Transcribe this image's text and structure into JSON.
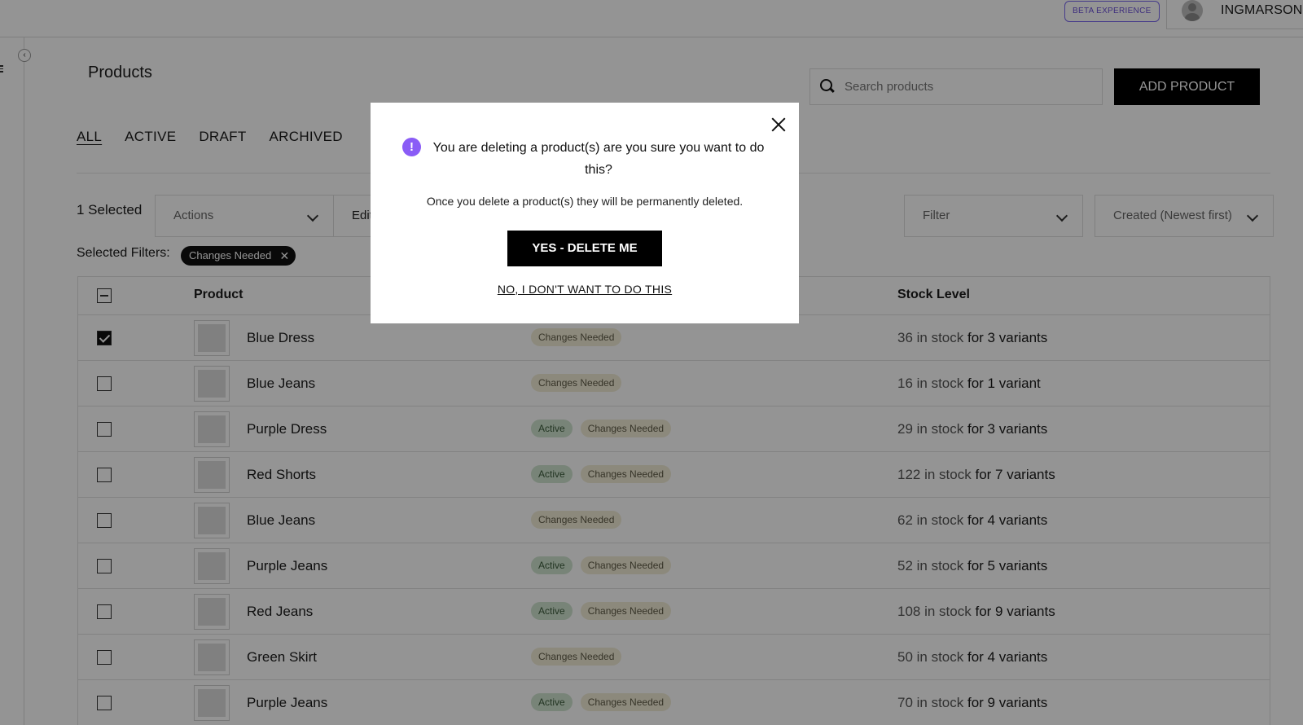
{
  "header": {
    "beta_label": "BETA EXPERIENCE",
    "username": "INGMARSON"
  },
  "page": {
    "title": "Products",
    "search_placeholder": "Search products",
    "add_button": "ADD PRODUCT",
    "tabs": [
      "ALL",
      "ACTIVE",
      "DRAFT",
      "ARCHIVED"
    ],
    "active_tab": "ALL",
    "selected_count": "1 Selected",
    "actions_label": "Actions",
    "edit_label": "Edit",
    "filter_label": "Filter",
    "sort_label": "Created (Newest first)",
    "selected_filters_label": "Selected Filters:",
    "filter_chip": "Changes Needed"
  },
  "table": {
    "headers": {
      "product": "Product",
      "stock": "Stock Level"
    },
    "rows": [
      {
        "name": "Blue Dress",
        "checked": true,
        "badges": [
          "Changes Needed"
        ],
        "stock_a": "36 in stock",
        "stock_b": "for 3 variants"
      },
      {
        "name": "Blue Jeans",
        "checked": false,
        "badges": [
          "Changes Needed"
        ],
        "stock_a": "16 in stock",
        "stock_b": "for 1 variant"
      },
      {
        "name": "Purple Dress",
        "checked": false,
        "badges": [
          "Active",
          "Changes Needed"
        ],
        "stock_a": "29 in stock",
        "stock_b": "for 3 variants"
      },
      {
        "name": "Red Shorts",
        "checked": false,
        "badges": [
          "Active",
          "Changes Needed"
        ],
        "stock_a": "122 in stock",
        "stock_b": "for 7 variants"
      },
      {
        "name": "Blue Jeans",
        "checked": false,
        "badges": [
          "Changes Needed"
        ],
        "stock_a": "62 in stock",
        "stock_b": "for 4 variants"
      },
      {
        "name": "Purple Jeans",
        "checked": false,
        "badges": [
          "Active",
          "Changes Needed"
        ],
        "stock_a": "52 in stock",
        "stock_b": "for 5 variants"
      },
      {
        "name": "Red Jeans",
        "checked": false,
        "badges": [
          "Active",
          "Changes Needed"
        ],
        "stock_a": "108 in stock",
        "stock_b": "for 9 variants"
      },
      {
        "name": "Green Skirt",
        "checked": false,
        "badges": [
          "Changes Needed"
        ],
        "stock_a": "50 in stock",
        "stock_b": "for 4 variants"
      },
      {
        "name": "Purple Jeans",
        "checked": false,
        "badges": [
          "Active",
          "Changes Needed"
        ],
        "stock_a": "70 in stock",
        "stock_b": "for 9 variants"
      }
    ]
  },
  "modal": {
    "title": "You are deleting a product(s) are you sure you want to do this?",
    "body": "Once you delete a product(s) they will be permanently deleted.",
    "confirm_button": "YES - DELETE ME",
    "cancel_link": "NO, I DON'T WANT TO DO THIS",
    "warn_icon_glyph": "!",
    "close_icon": "close-icon",
    "accent_color": "#8a5cf6"
  },
  "colors": {
    "overlay": "rgba(0,0,0,0.42)",
    "badge_active": "#cfe3cf",
    "badge_changes": "#f2ecd6",
    "primary_button": "#000000"
  }
}
